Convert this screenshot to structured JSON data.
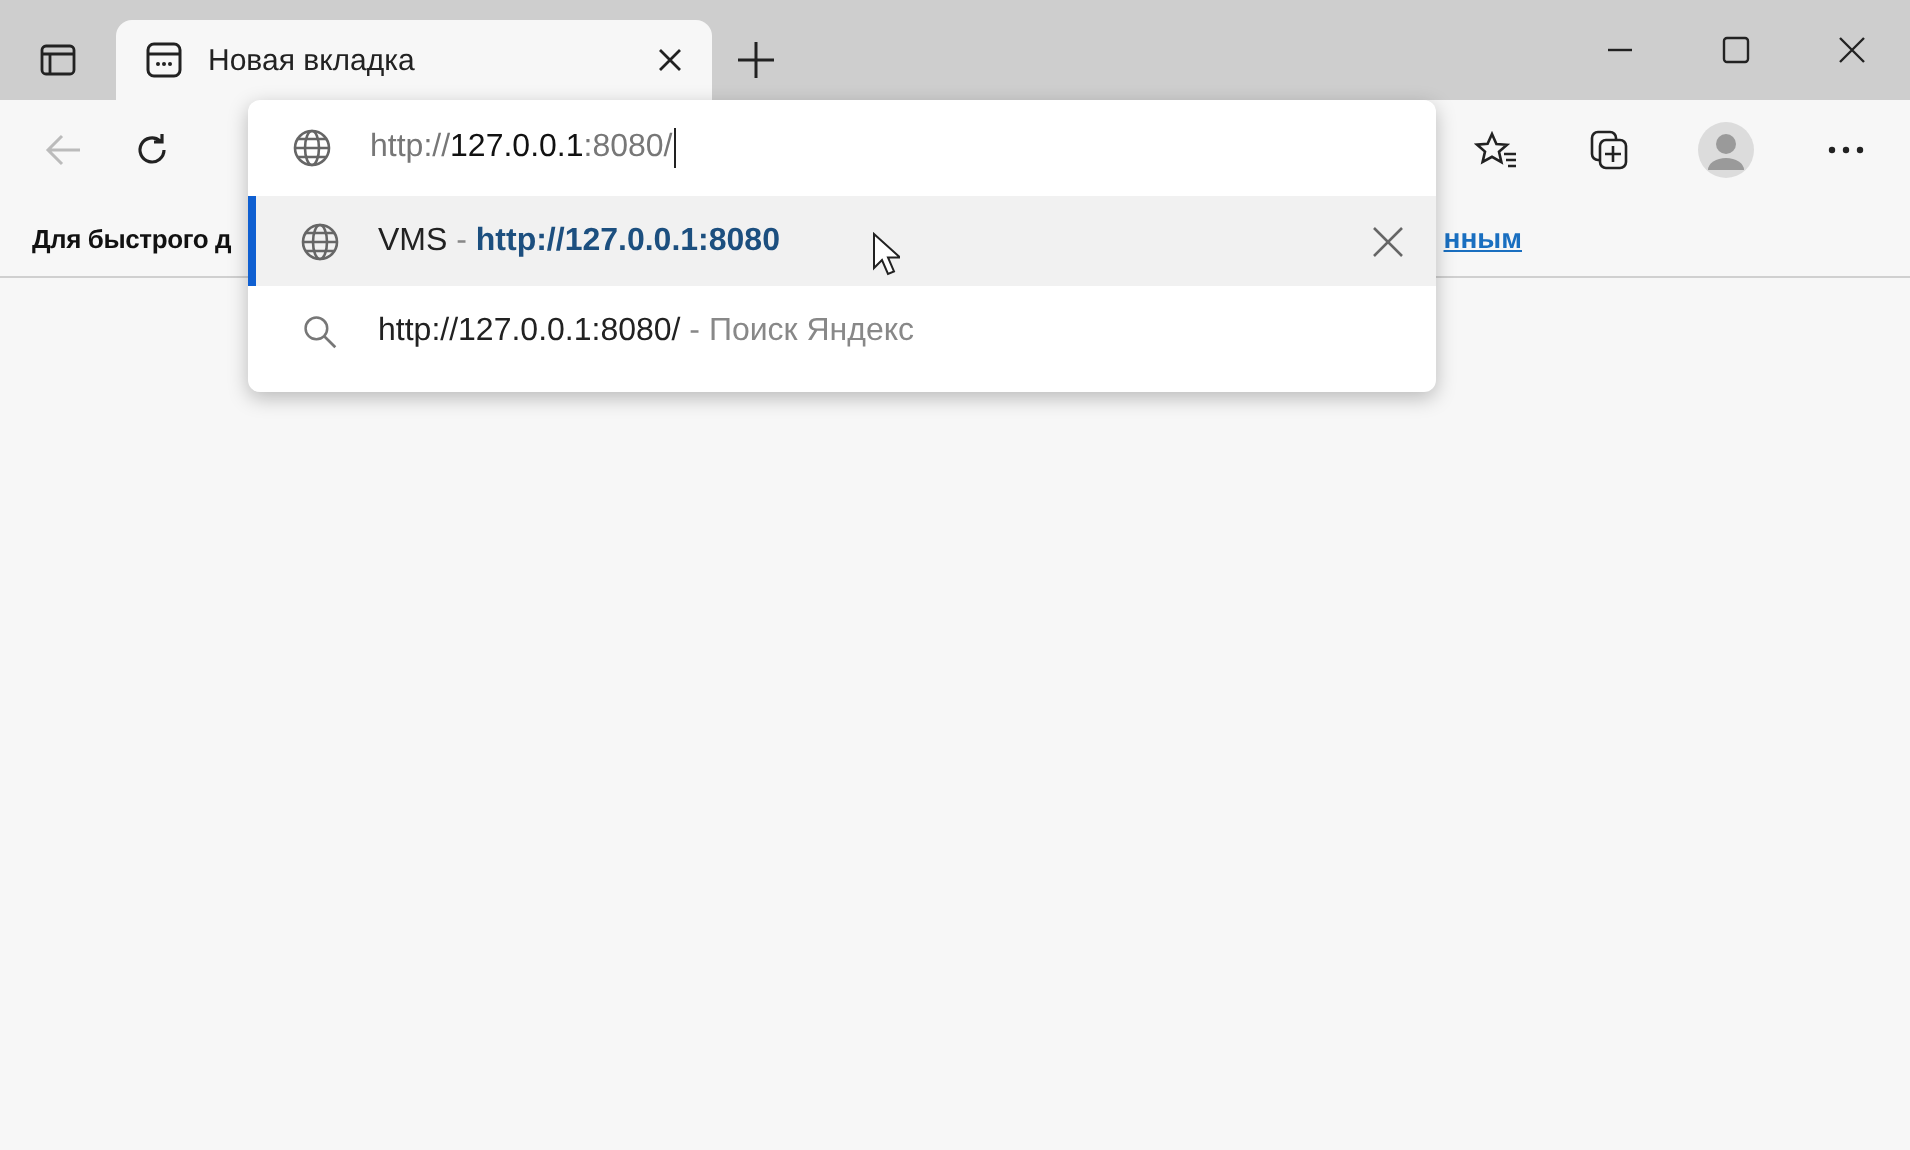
{
  "tab": {
    "title": "Новая вкладка",
    "selected": true
  },
  "bookmarks_bar": {
    "left_text": "Для быстрого д",
    "right_link": "нным"
  },
  "address": {
    "parts": [
      {
        "text": "http://",
        "kind": "dim"
      },
      {
        "text": "127.0.0.1",
        "kind": "host"
      },
      {
        "text": ":8080/",
        "kind": "dim"
      }
    ]
  },
  "suggestions": [
    {
      "kind": "history",
      "selected": true,
      "title": "VMS",
      "separator": "-",
      "detail": "http://127.0.0.1:8080"
    },
    {
      "kind": "search",
      "selected": false,
      "title": "http://127.0.0.1:8080/",
      "separator": "-",
      "detail": "Поиск Яндекс"
    }
  ]
}
